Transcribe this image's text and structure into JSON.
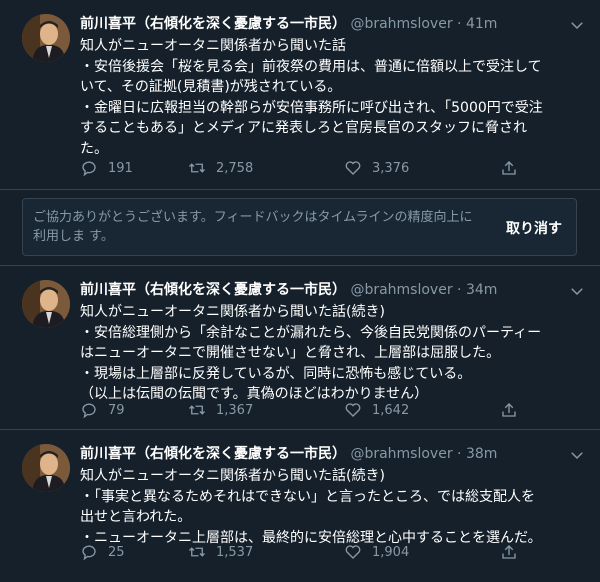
{
  "tweets": [
    {
      "author": "前川喜平（右傾化を深く憂慮する一市民）",
      "handle": "@brahmslover",
      "dot": "·",
      "time": "41m",
      "lines": [
        "知人がニューオータニ関係者から聞いた話",
        "・安倍後援会「桜を見る会」前夜祭の費用は、普通に倍額以上で受注して",
        "いて、その証拠(見積書)が残されている。",
        "・金曜日に広報担当の幹部らが安倍事務所に呼び出され、「5000円で受注",
        "することもある」とメディアに発表しろと官房長官のスタッフに脅され",
        "た。"
      ],
      "replies": "191",
      "retweets": "2,758",
      "likes": "3,376"
    },
    {
      "author": "前川喜平（右傾化を深く憂慮する一市民）",
      "handle": "@brahmslover",
      "dot": "·",
      "time": "34m",
      "lines": [
        "知人がニューオータニ関係者から聞いた話(続き)",
        "・安倍総理側から「余計なことが漏れたら、今後自民党関係のパーティー",
        "はニューオータニで開催させない」と脅され、上層部は屈服した。",
        "・現場は上層部に反発しているが、同時に恐怖も感じている。",
        "（以上は伝聞の伝聞です。真偽のほどはわかりません）"
      ],
      "replies": "79",
      "retweets": "1,367",
      "likes": "1,642"
    },
    {
      "author": "前川喜平（右傾化を深く憂慮する一市民）",
      "handle": "@brahmslover",
      "dot": "·",
      "time": "38m",
      "lines": [
        "知人がニューオータニ関係者から聞いた話(続き)",
        "・「事実と異なるためそれはできない」と言ったところ、では総支配人を",
        "出せと言われた。",
        "・ニューオータニ上層部は、最終的に安倍総理と心中することを選んだ。"
      ],
      "replies": "25",
      "retweets": "1,537",
      "likes": "1,904"
    }
  ],
  "feedback": {
    "message": "ご協力ありがとうございます。フィードバックはタイムラインの精度向上に利用しま す。",
    "undo_label": "取り消す"
  },
  "colors": {
    "background": "#15202b",
    "border": "#38444d",
    "secondary_text": "#8899a6"
  },
  "icons": [
    "reply-icon",
    "retweet-icon",
    "like-icon",
    "share-icon",
    "chevron-down-icon"
  ]
}
